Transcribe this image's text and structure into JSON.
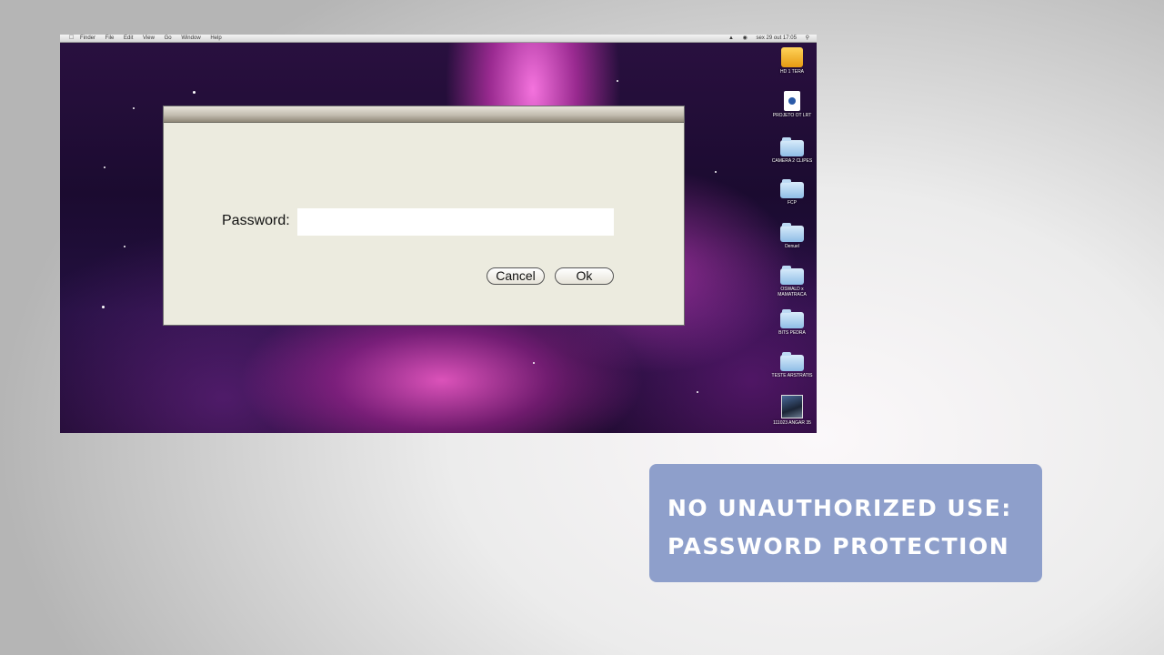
{
  "menubar": {
    "apple_icon": "apple-icon",
    "menus": [
      "Finder",
      "File",
      "Edit",
      "View",
      "Go",
      "Window",
      "Help"
    ],
    "clock": "sex 29 out 17:05"
  },
  "desktop_icons": [
    {
      "label": "HD 1 TERA",
      "icon": "drive-icon"
    },
    {
      "label": "PROJETO OT LRT",
      "icon": "document-icon"
    },
    {
      "label": "CAMERA 2 CLIPES",
      "icon": "folder-icon"
    },
    {
      "label": "FCP",
      "icon": "folder-icon"
    },
    {
      "label": "Denuel",
      "icon": "folder-icon"
    },
    {
      "label": "OSWALD x MAMATRACA",
      "icon": "folder-icon"
    },
    {
      "label": "BITS PEDRA",
      "icon": "folder-icon"
    },
    {
      "label": "TESTE ARSTRATIS",
      "icon": "folder-icon"
    },
    {
      "label": "111023 ANGAR 35",
      "icon": "photo-icon"
    }
  ],
  "dialog": {
    "password_label": "Password:",
    "password_value": "",
    "cancel_label": "Cancel",
    "ok_label": "Ok"
  },
  "caption": {
    "line1": "NO UNAUTHORIZED USE:",
    "line2": "PASSWORD PROTECTION",
    "background_color": "#8e9fcb"
  }
}
